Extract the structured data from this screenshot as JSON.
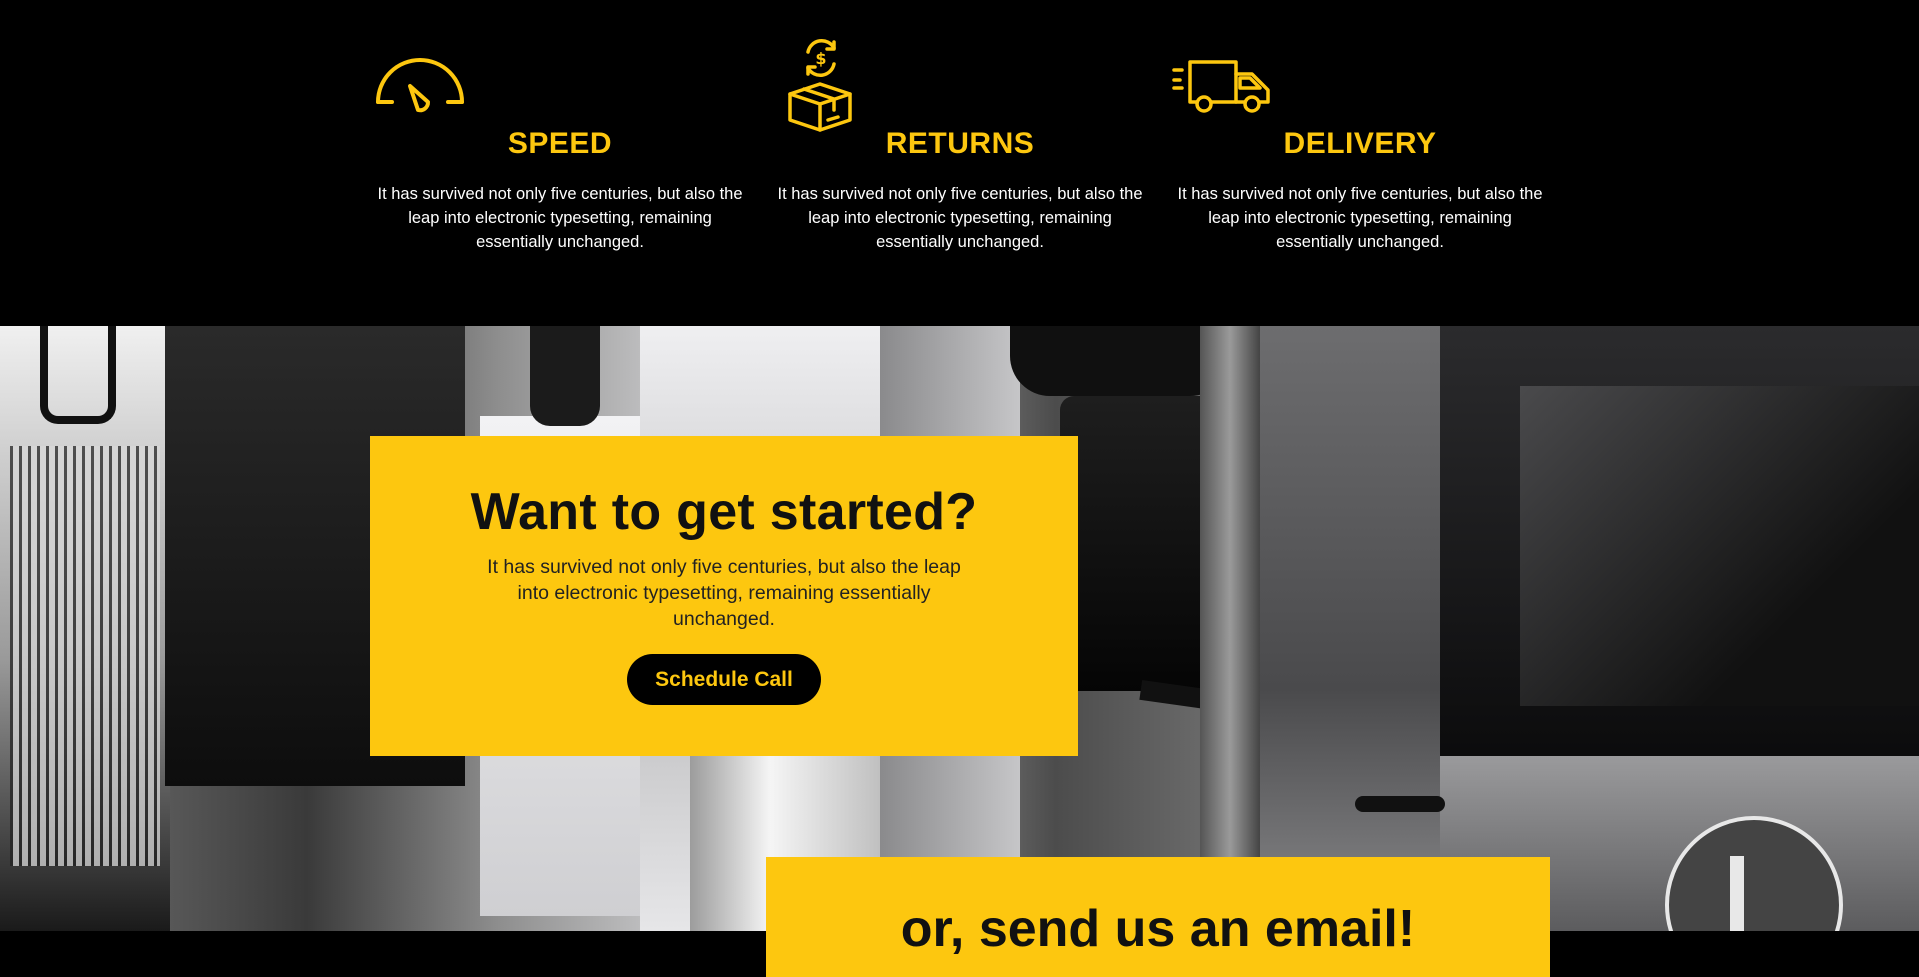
{
  "colors": {
    "accent": "#fdc70f",
    "background": "#000000",
    "text_light": "#ffffff",
    "text_dark": "#111111"
  },
  "features": [
    {
      "icon": "speedometer-icon",
      "title": "SPEED",
      "description": "It has survived not only five centuries, but also the leap into electronic typesetting, remaining essentially unchanged."
    },
    {
      "icon": "returns-box-icon",
      "title": "RETURNS",
      "description": "It has survived not only five centuries, but also the leap into electronic typesetting, remaining essentially unchanged."
    },
    {
      "icon": "delivery-truck-icon",
      "title": "DELIVERY",
      "description": "It has survived not only five centuries, but also the leap into electronic typesetting, remaining essentially unchanged."
    }
  ],
  "cta": {
    "heading": "Want to get started?",
    "description": "It has survived not only five centuries, but also the leap into electronic typesetting, remaining essentially unchanged.",
    "button_label": "Schedule Call"
  },
  "email": {
    "heading": "or, send us an email!"
  }
}
